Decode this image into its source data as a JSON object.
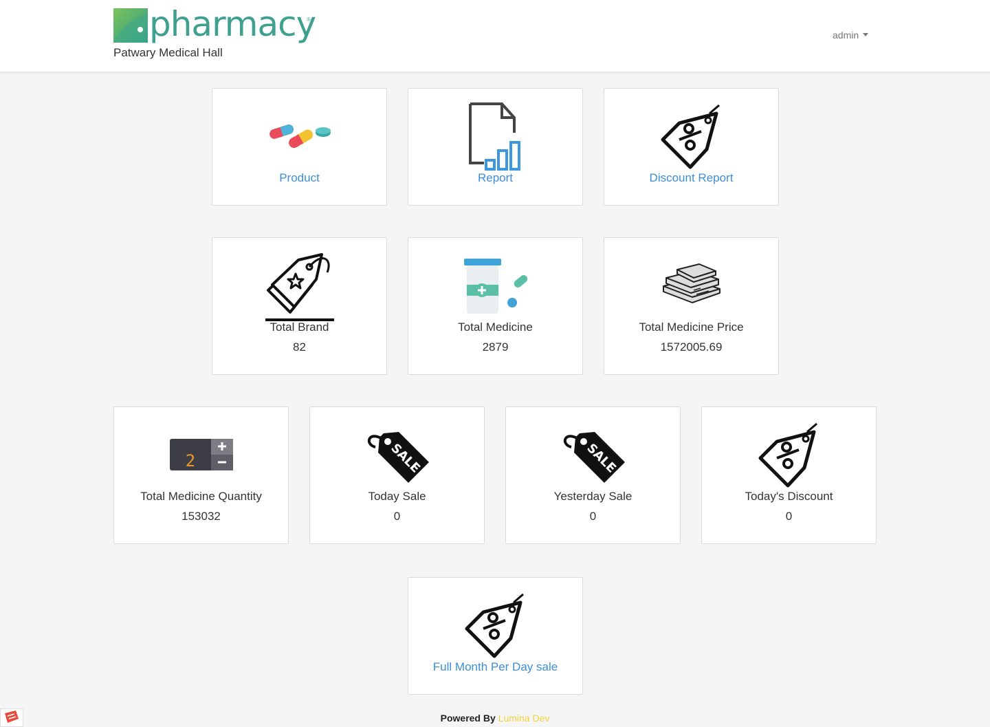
{
  "header": {
    "logo_text": "pharmacy",
    "logo_registered": "®",
    "subtitle": "Patwary Medical Hall",
    "user_menu": "admin"
  },
  "cards": {
    "product": {
      "label": "Product",
      "icon": "pills-icon"
    },
    "report": {
      "label": "Report",
      "icon": "report-chart-icon"
    },
    "discount_report": {
      "label": "Discount Report",
      "icon": "discount-tag-icon"
    },
    "total_brand": {
      "label": "Total Brand",
      "value": "82",
      "icon": "brand-tag-icon"
    },
    "total_medicine": {
      "label": "Total Medicine",
      "value": "2879",
      "icon": "medicine-bottle-icon"
    },
    "total_medicine_price": {
      "label": "Total Medicine Price",
      "value": "1572005.69",
      "icon": "money-stack-icon"
    },
    "total_medicine_quantity": {
      "label": "Total Medicine Quantity",
      "value": "153032",
      "icon": "quantity-counter-icon"
    },
    "today_sale": {
      "label": "Today Sale",
      "value": "0",
      "icon": "sale-tag-icon"
    },
    "yesterday_sale": {
      "label": "Yesterday Sale",
      "value": "0",
      "icon": "sale-tag-icon"
    },
    "todays_discount": {
      "label": "Today's Discount",
      "value": "0",
      "icon": "discount-tag-icon"
    },
    "full_month": {
      "label": "Full Month Per Day sale",
      "icon": "discount-tag-icon"
    },
    "quantity_digit": "2",
    "sale_tag_text": "SALE"
  },
  "footer": {
    "powered_by": "Powered By",
    "brand": "Lumina Dev"
  },
  "colors": {
    "link": "#3b8ed8",
    "logo": "#3fa08e",
    "footer_brand": "#f3d13b"
  }
}
